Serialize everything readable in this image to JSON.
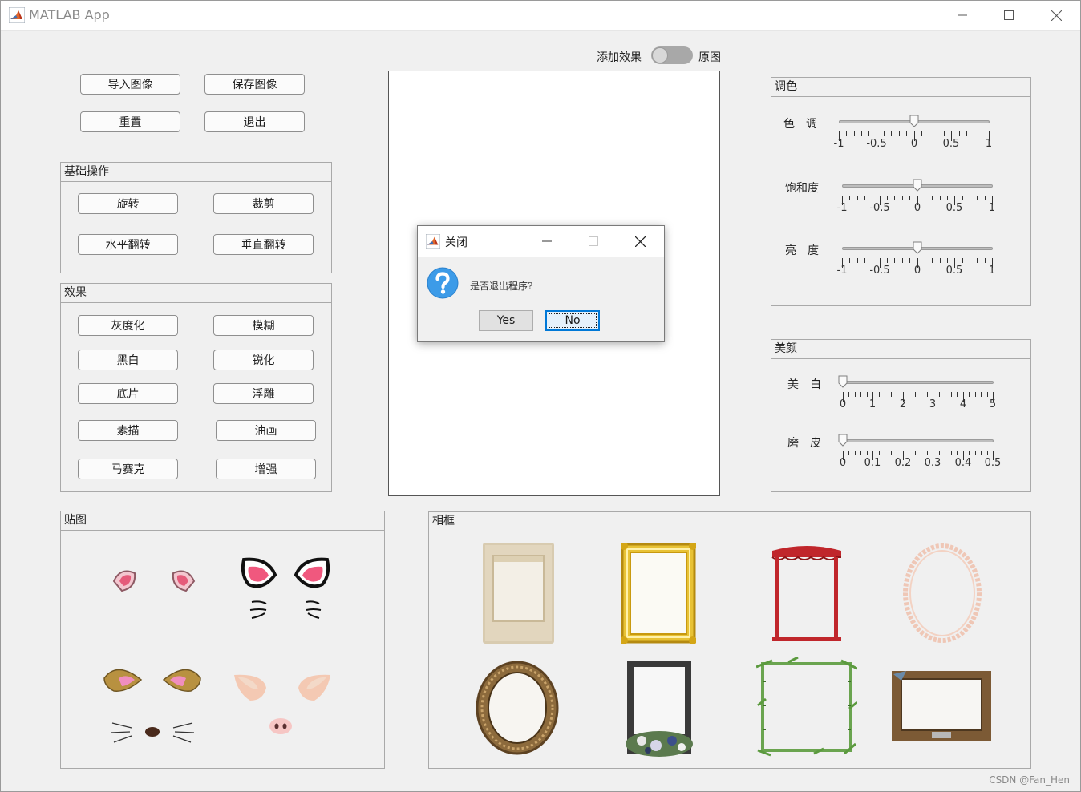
{
  "window": {
    "title": "MATLAB App"
  },
  "top_buttons": {
    "import": "导入图像",
    "save": "保存图像",
    "reset": "重置",
    "exit": "退出"
  },
  "basic_panel": {
    "title": "基础操作",
    "rotate": "旋转",
    "crop": "裁剪",
    "hflip": "水平翻转",
    "vflip": "垂直翻转"
  },
  "effects_panel": {
    "title": "效果",
    "buttons": [
      "灰度化",
      "模糊",
      "黑白",
      "锐化",
      "底片",
      "浮雕",
      "素描",
      "油画",
      "马赛克",
      "增强"
    ]
  },
  "switch": {
    "left_label": "添加效果",
    "right_label": "原图",
    "state": "off"
  },
  "color_panel": {
    "title": "调色",
    "sliders": [
      {
        "label": "色　调",
        "value": 0,
        "ticks": [
          "-1",
          "-0.5",
          "0",
          "0.5",
          "1"
        ]
      },
      {
        "label": "饱和度",
        "value": 0,
        "ticks": [
          "-1",
          "-0.5",
          "0",
          "0.5",
          "1"
        ]
      },
      {
        "label": "亮　度",
        "value": 0,
        "ticks": [
          "-1",
          "-0.5",
          "0",
          "0.5",
          "1"
        ]
      }
    ]
  },
  "beauty_panel": {
    "title": "美颜",
    "sliders": [
      {
        "label": "美　白",
        "value": 0,
        "ticks": [
          "0",
          "1",
          "2",
          "3",
          "4",
          "5"
        ]
      },
      {
        "label": "磨　皮",
        "value": 0,
        "ticks": [
          "0",
          "0.1",
          "0.2",
          "0.3",
          "0.4",
          "0.5"
        ]
      }
    ]
  },
  "stickers_panel": {
    "title": "贴图"
  },
  "frames_panel": {
    "title": "相框"
  },
  "dialog": {
    "title": "关闭",
    "message": "是否退出程序?",
    "yes": "Yes",
    "no": "No"
  },
  "watermark": "CSDN @Fan_Hen",
  "colors": {
    "accent_blue": "#3c9be8",
    "frame_red": "#c0262b",
    "slider_track": "#bdbdbd"
  }
}
